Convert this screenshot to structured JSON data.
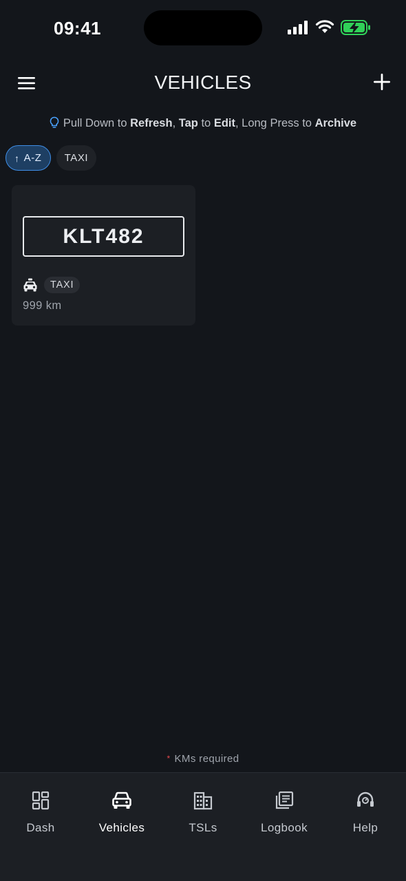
{
  "status_bar": {
    "time": "09:41",
    "icons": [
      "cellular-signal-icon",
      "wifi-icon",
      "battery-charging-icon"
    ],
    "battery_color": "#30d158"
  },
  "header": {
    "title": "VEHICLES",
    "menu_icon": "hamburger-menu-icon",
    "add_icon": "plus-icon"
  },
  "hint": {
    "icon": "lightbulb-icon",
    "part1": "Pull Down to ",
    "bold1": "Refresh",
    "sep1": ",  ",
    "bold2": "Tap",
    "part2": " to ",
    "bold3": "Edit",
    "sep2": ",  ",
    "part3": "Long Press to ",
    "bold4": "Archive"
  },
  "chips": {
    "sort": {
      "arrow": "↑",
      "label": "A-Z"
    },
    "filter": {
      "label": "TAXI"
    }
  },
  "vehicles": [
    {
      "plate": "KLT482",
      "type_icon": "taxi-icon",
      "type": "TAXI",
      "km": "999 km"
    }
  ],
  "footer_note": {
    "star": "*",
    "text": "KMs required"
  },
  "tabs": [
    {
      "label": "Dash",
      "icon": "dashboard-icon",
      "active": false
    },
    {
      "label": "Vehicles",
      "icon": "car-icon",
      "active": true
    },
    {
      "label": "TSLs",
      "icon": "building-icon",
      "active": false
    },
    {
      "label": "Logbook",
      "icon": "logbook-icon",
      "active": false
    },
    {
      "label": "Help",
      "icon": "headset-icon",
      "active": false
    }
  ],
  "colors": {
    "background": "#13161b",
    "card": "#1c1f24",
    "accent": "#3f8ee6",
    "required_star": "#e5484d"
  }
}
